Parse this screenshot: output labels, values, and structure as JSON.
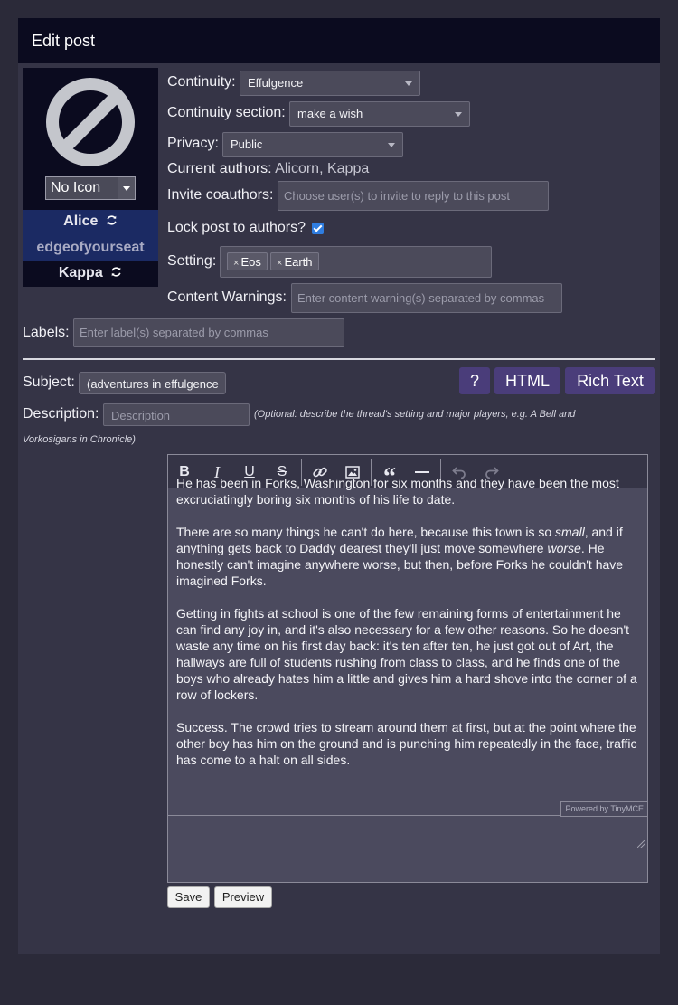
{
  "header": {
    "title": "Edit post"
  },
  "icon_panel": {
    "icon_select_value": "No Icon",
    "authors": [
      {
        "name": "Alice",
        "refresh_icon": "refresh-icon"
      },
      {
        "name": "edgeofyourseat"
      },
      {
        "name": "Kappa",
        "refresh_icon": "refresh-icon"
      }
    ]
  },
  "form": {
    "continuity_label": "Continuity:",
    "continuity_value": "Effulgence",
    "section_label": "Continuity section:",
    "section_value": "make a wish",
    "privacy_label": "Privacy:",
    "privacy_value": "Public",
    "current_authors_label": "Current authors:",
    "current_authors_value": "Alicorn, Kappa",
    "invite_label": "Invite coauthors:",
    "invite_placeholder": "Choose user(s) to invite to reply to this post",
    "lock_label": "Lock post to authors?",
    "lock_checked": true,
    "setting_label": "Setting:",
    "setting_tags": [
      "Eos",
      "Earth"
    ],
    "cw_label": "Content Warnings:",
    "cw_placeholder": "Enter content warning(s) separated by commas",
    "labels_label": "Labels:",
    "labels_placeholder": "Enter label(s) separated by commas",
    "subject_label": "Subject:",
    "subject_value": "(adventures in effulgence",
    "description_label": "Description:",
    "description_placeholder": "Description",
    "description_hint_line1": "(Optional: describe the thread's setting and major players, e.g. A Bell and",
    "description_hint_line2": "Vorkosigans in Chronicle)"
  },
  "mode_buttons": {
    "help": "?",
    "html": "HTML",
    "rich_text": "Rich Text"
  },
  "editor": {
    "paragraphs": [
      [
        "He has been in Forks, Washington for six months and they have been the most excruciatingly boring six months of his life to date."
      ],
      [
        "There are so many things he can't do here, because this town is so ",
        {
          "i": "small"
        },
        ", and if anything gets back to Daddy dearest they'll just move somewhere ",
        {
          "i": "worse"
        },
        ". He honestly can't imagine anywhere worse, but then, before Forks he couldn't have imagined Forks."
      ],
      [
        "Getting in fights at school is one of the few remaining forms of entertainment he can find any joy in, and it's also necessary for a few other reasons. So he doesn't waste any time on his first day back: it's ten after ten, he just got out of Art, the hallways are full of students rushing from class to class, and he finds one of the boys who already hates him a little and gives him a hard shove into the corner of a row of lockers."
      ],
      [
        "Success. The crowd tries to stream around them at first, but at the point where the other boy has him on the ground and is punching him repeatedly in the face, traffic has come to a halt on all sides."
      ]
    ],
    "powered_by": "Powered by TinyMCE",
    "toolbar": [
      "bold-icon",
      "italic-icon",
      "underline-icon",
      "strikethrough-icon",
      "link-icon",
      "image-icon",
      "blockquote-icon",
      "horizontal-rule-icon",
      "undo-icon",
      "redo-icon"
    ]
  },
  "actions": {
    "save": "Save",
    "preview": "Preview"
  },
  "colors": {
    "page_bg": "#2b2a39",
    "panel_bg": "#353446",
    "header_bg": "#0b0b1f",
    "accent_button": "#4a3d7a",
    "checkbox": "#2f7de0"
  }
}
